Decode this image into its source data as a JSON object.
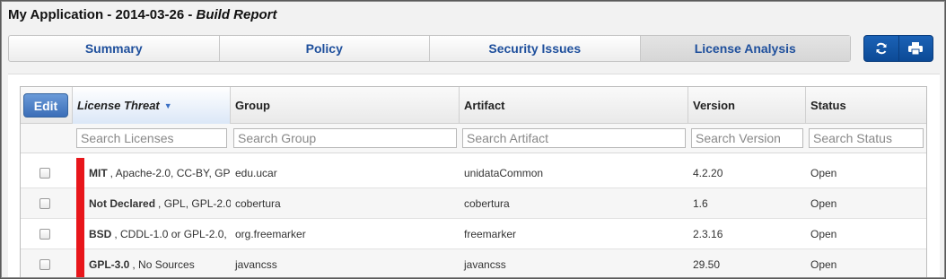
{
  "header": {
    "title_prefix": "My Application - 2014-03-26 - ",
    "title_italic": "Build Report"
  },
  "tabs": [
    {
      "label": "Summary",
      "active": false
    },
    {
      "label": "Policy",
      "active": false
    },
    {
      "label": "Security Issues",
      "active": false
    },
    {
      "label": "License Analysis",
      "active": true
    }
  ],
  "toolbar": {
    "refresh_icon": "refresh-icon",
    "print_icon": "print-icon"
  },
  "grid": {
    "edit_label": "Edit",
    "columns": {
      "license": "License Threat",
      "group": "Group",
      "artifact": "Artifact",
      "version": "Version",
      "status": "Status"
    },
    "filters": {
      "license": "Search Licenses",
      "group": "Search Group",
      "artifact": "Search Artifact",
      "version": "Search Version",
      "status": "Search Status"
    },
    "threat_color": "#e8161b",
    "rows": [
      {
        "license_main": "MIT",
        "license_rest": ", Apache-2.0, CC-BY, GP",
        "group": "edu.ucar",
        "artifact": "unidataCommon",
        "version": "4.2.20",
        "status": "Open"
      },
      {
        "license_main": "Not Declared",
        "license_rest": ", GPL, GPL-2.0",
        "group": "cobertura",
        "artifact": "cobertura",
        "version": "1.6",
        "status": "Open"
      },
      {
        "license_main": "BSD",
        "license_rest": ", CDDL-1.0 or GPL-2.0,",
        "group": "org.freemarker",
        "artifact": "freemarker",
        "version": "2.3.16",
        "status": "Open"
      },
      {
        "license_main": "GPL-3.0",
        "license_rest": ", No Sources",
        "group": "javancss",
        "artifact": "javancss",
        "version": "29.50",
        "status": "Open"
      }
    ]
  }
}
